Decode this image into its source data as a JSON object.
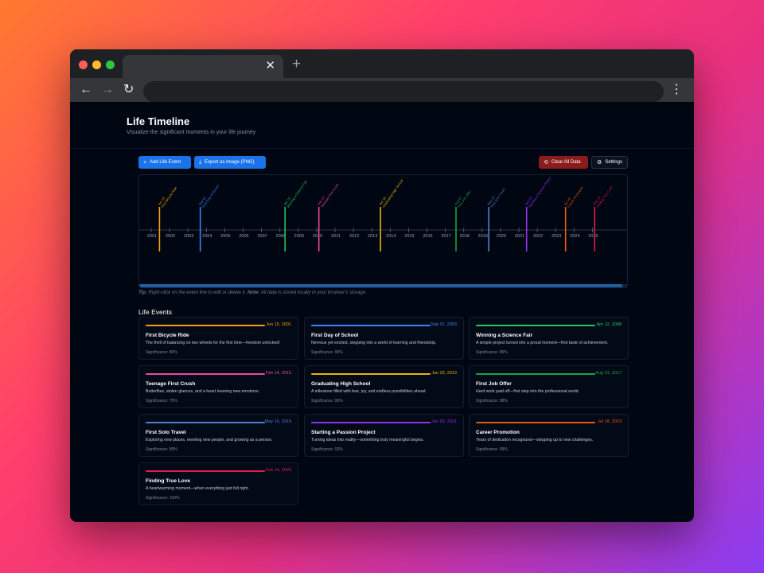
{
  "browser": {
    "tab_close": "✕",
    "new_tab": "+",
    "back": "←",
    "forward": "→",
    "reload": "↻",
    "menu": "⋮",
    "traffic_lights": [
      "#ff5f57",
      "#febc2e",
      "#28c840"
    ]
  },
  "header": {
    "title": "Life Timeline",
    "subtitle": "Visualize the significant moments in your life journey"
  },
  "actions": {
    "add": "Add Life Event",
    "export": "Export as Image (PNG)",
    "clear": "Clear All Data",
    "settings": "Settings"
  },
  "timeline": {
    "years": [
      "2001",
      "2002",
      "2003",
      "2004",
      "2005",
      "2006",
      "2007",
      "2008",
      "2009",
      "2010",
      "2011",
      "2012",
      "2013",
      "2014",
      "2015",
      "2016",
      "2017",
      "2018",
      "2019",
      "2020",
      "2021",
      "2022",
      "2023",
      "2024",
      "2025"
    ],
    "markers": [
      {
        "date": "Jun 15",
        "title": "First Bicycle Ride",
        "color": "#f59e0b",
        "year": 2001.45
      },
      {
        "date": "Sep 01",
        "title": "First Day of School",
        "color": "#3b82f6",
        "year": 2003.67
      },
      {
        "date": "Apr 12",
        "title": "Winning a Science Fair",
        "color": "#22c55e",
        "year": 2008.28
      },
      {
        "date": "Feb 14",
        "title": "Teenage First Crush",
        "color": "#ec4899",
        "year": 2010.12
      },
      {
        "date": "Jun 20",
        "title": "Graduating High School",
        "color": "#eab308",
        "year": 2013.47
      },
      {
        "date": "Aug 01",
        "title": "First Job Offer",
        "color": "#16a34a",
        "year": 2017.58
      },
      {
        "date": "May 10",
        "title": "First Solo Travel",
        "color": "#4f7fcf",
        "year": 2019.36
      },
      {
        "date": "Jun 03",
        "title": "Starting a Passion Project",
        "color": "#9333ea",
        "year": 2021.42
      },
      {
        "date": "Jul 18",
        "title": "Career Promotion",
        "color": "#ea580c",
        "year": 2023.54
      },
      {
        "date": "Feb 14",
        "title": "Finding True Love",
        "color": "#e11d48",
        "year": 2025.12
      }
    ]
  },
  "tip": {
    "lead": "Tip:",
    "text": " Right-click on the event line to edit or delete it. ",
    "note_lead": "Note:",
    "note": " All data is stored locally in your browser's storage."
  },
  "events_section": {
    "title": "Life Events",
    "events": [
      {
        "title": "First Bicycle Ride",
        "date": "Jun 15, 2001",
        "description": "The thrill of balancing on two wheels for the first time—freedom unlocked!",
        "significance": "Significance: 80%",
        "color": "#f59e0b"
      },
      {
        "title": "First Day of School",
        "date": "Sep 01, 2003",
        "description": "Nervous yet excited, stepping into a world of learning and friendship.",
        "significance": "Significance: 90%",
        "color": "#3b82f6"
      },
      {
        "title": "Winning a Science Fair",
        "date": "Apr 12, 2008",
        "description": "A simple project turned into a proud moment—first taste of achievement.",
        "significance": "Significance: 85%",
        "color": "#22c55e"
      },
      {
        "title": "Teenage First Crush",
        "date": "Feb 14, 2010",
        "description": "Butterflies, stolen glances, and a heart learning new emotions.",
        "significance": "Significance: 75%",
        "color": "#ec4899"
      },
      {
        "title": "Graduating High School",
        "date": "Jun 20, 2013",
        "description": "A milestone filled with fear, joy, and endless possibilities ahead.",
        "significance": "Significance: 95%",
        "color": "#eab308"
      },
      {
        "title": "First Job Offer",
        "date": "Aug 01, 2017",
        "description": "Hard work paid off—first step into the professional world.",
        "significance": "Significance: 98%",
        "color": "#16a34a"
      },
      {
        "title": "First Solo Travel",
        "date": "May 10, 2019",
        "description": "Exploring new places, meeting new people, and growing as a person.",
        "significance": "Significance: 88%",
        "color": "#4f7fcf"
      },
      {
        "title": "Starting a Passion Project",
        "date": "Jun 03, 2021",
        "description": "Turning ideas into reality—something truly meaningful begins.",
        "significance": "Significance: 92%",
        "color": "#9333ea"
      },
      {
        "title": "Career Promotion",
        "date": "Jul 18, 2023",
        "description": "Years of dedication recognized—stepping up to new challenges.",
        "significance": "Significance: 99%",
        "color": "#ea580c"
      },
      {
        "title": "Finding True Love",
        "date": "Feb 14, 2025",
        "description": "A heartwarming moment—when everything just felt right.",
        "significance": "Significance: 100%",
        "color": "#e11d48"
      }
    ]
  }
}
